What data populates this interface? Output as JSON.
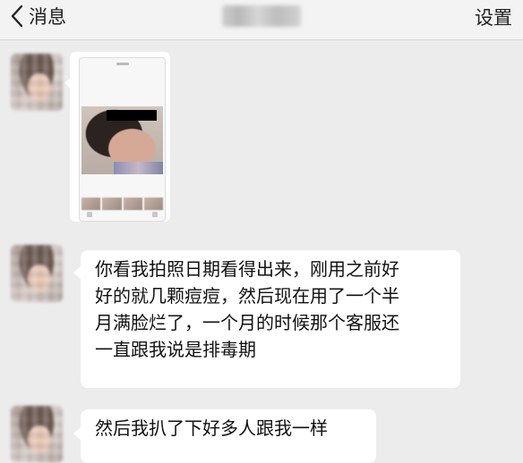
{
  "header": {
    "back_label": "消息",
    "settings_label": "设置",
    "title_hidden": true
  },
  "messages": [
    {
      "type": "image",
      "description_icon": "photo-screenshot"
    },
    {
      "type": "text",
      "lines": [
        "你看我拍照日期看得出来，刚用之前好",
        "好的就几颗痘痘，然后现在用了一个半",
        "月满脸烂了，一个月的时候那个客服还",
        "一直跟我说是排毒期"
      ]
    },
    {
      "type": "text",
      "lines": [
        "然后我扒了下好多人跟我一样"
      ]
    }
  ],
  "colors": {
    "background": "#ececec",
    "bubble": "#ffffff",
    "text": "#111111"
  }
}
